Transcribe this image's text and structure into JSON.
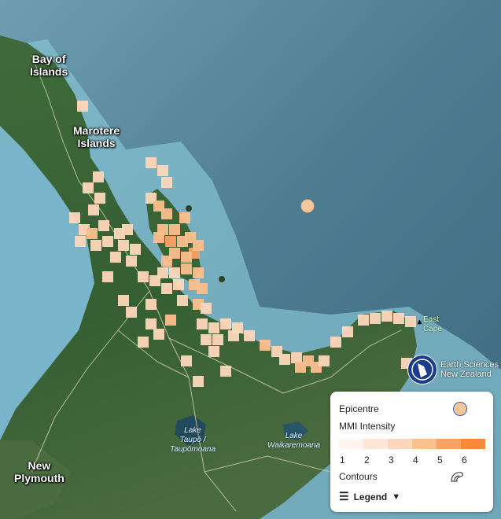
{
  "map": {
    "places": {
      "bay_of_islands": "Bay of\nIslands",
      "marotere": "Marotere\nIslands",
      "new_plymouth": "New\nPlymouth",
      "lake_taupo": "Lake\nTaupō /\nTaupōmoana",
      "lake_waikaremoana": "Lake\nWaikaremoana",
      "east_cape": "East\nCape"
    },
    "intensity_colors": [
      "#fff4ee",
      "#ffe6d6",
      "#fdd7bb",
      "#fcbf8e",
      "#f9a266",
      "#f8883a"
    ],
    "epicentre_color": "#f6c79a"
  },
  "brand": {
    "name": "Earth Sciences",
    "sub": "New Zealand"
  },
  "legend": {
    "epicentre_label": "Epicentre",
    "mmi_label": "MMI Intensity",
    "mmi_levels": [
      "1",
      "2",
      "3",
      "4",
      "5",
      "6"
    ],
    "contours_label": "Contours",
    "toggle_label": "Legend"
  }
}
